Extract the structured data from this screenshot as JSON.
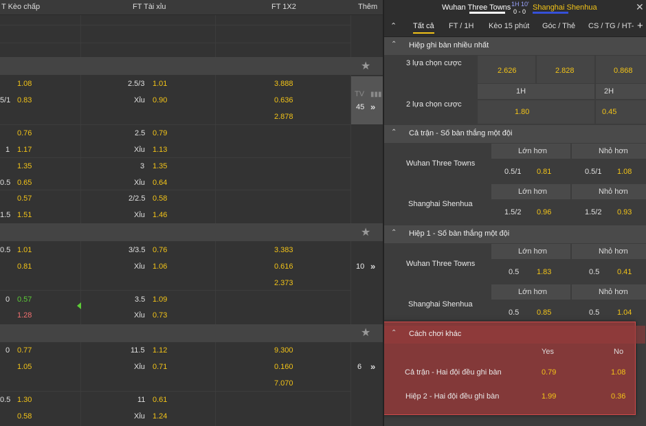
{
  "left": {
    "headers": {
      "handicap": "T Kèo chấp",
      "ou": "FT Tài xỉu",
      "x12": "FT 1X2",
      "more": "Thêm"
    },
    "tv": {
      "label": "TV",
      "count": "45"
    },
    "more_counts": [
      "10",
      "6"
    ],
    "rows": [
      {
        "h_line": "",
        "h_odds": "1.08",
        "o_line": "2.5/3",
        "o_odds": "1.01",
        "x": "3.888"
      },
      {
        "h_line": "5/1",
        "h_odds": "0.83",
        "o_line": "Xỉu",
        "o_odds": "0.90",
        "x": "0.636"
      },
      {
        "x": "2.878"
      },
      {
        "h_line": "",
        "h_odds": "0.76",
        "o_line": "2.5",
        "o_odds": "0.79"
      },
      {
        "h_line": "1",
        "h_odds": "1.17",
        "o_line": "Xỉu",
        "o_odds": "1.13"
      },
      {
        "h_line": "",
        "h_odds": "1.35",
        "o_line": "3",
        "o_odds": "1.35"
      },
      {
        "h_line": "0.5",
        "h_odds": "0.65",
        "o_line": "Xỉu",
        "o_odds": "0.64"
      },
      {
        "h_line": "",
        "h_odds": "0.57",
        "o_line": "2/2.5",
        "o_odds": "0.58"
      },
      {
        "h_line": "1.5",
        "h_odds": "1.51",
        "o_line": "Xỉu",
        "o_odds": "1.46"
      },
      {
        "h_line": "0.5",
        "h_odds": "1.01",
        "o_line": "3/3.5",
        "o_odds": "0.76",
        "x": "3.383"
      },
      {
        "h_line": "",
        "h_odds": "0.81",
        "o_line": "Xỉu",
        "o_odds": "1.06",
        "x": "0.616"
      },
      {
        "x": "2.373"
      },
      {
        "h_line": "0",
        "h_odds": "0.57",
        "o_line": "3.5",
        "o_odds": "1.09"
      },
      {
        "h_line": "",
        "h_odds": "1.28",
        "o_line": "Xỉu",
        "o_odds": "0.73"
      },
      {
        "h_line": "0",
        "h_odds": "0.77",
        "o_line": "11.5",
        "o_odds": "1.12",
        "x": "9.300"
      },
      {
        "h_line": "",
        "h_odds": "1.05",
        "o_line": "Xỉu",
        "o_odds": "0.71",
        "x": "0.160"
      },
      {
        "x": "7.070"
      },
      {
        "h_line": "0.5",
        "h_odds": "1.30",
        "o_line": "11",
        "o_odds": "0.61"
      },
      {
        "h_line": "",
        "h_odds": "0.58",
        "o_line": "Xỉu",
        "o_odds": "1.24"
      }
    ]
  },
  "right": {
    "match": {
      "home": "Wuhan Three Towns",
      "time": "1H 10'",
      "score": "0 - 0",
      "away": "Shanghai Shenhua"
    },
    "tabs": [
      "Tất cả",
      "FT / 1H",
      "Kèo 15 phút",
      "Góc / Thẻ",
      "CS / TG / HT-"
    ],
    "s1": {
      "title": "Hiệp ghi bàn nhiều nhất",
      "r1_label": "3 lựa chọn cược",
      "r1_odds": [
        "2.626",
        "2.828",
        "0.868"
      ],
      "h1": "1H",
      "h2": "2H",
      "r2_label": "2 lựa chọn cược",
      "r2_odds": [
        "1.80",
        "0.45"
      ]
    },
    "s2": {
      "title": "Cả trận - Số bàn thắng một đội",
      "over": "Lớn hơn",
      "under": "Nhỏ hơn",
      "teams": [
        {
          "name": "Wuhan Three Towns",
          "ol": "0.5/1",
          "oo": "0.81",
          "ul": "0.5/1",
          "uo": "1.08"
        },
        {
          "name": "Shanghai Shenhua",
          "ol": "1.5/2",
          "oo": "0.96",
          "ul": "1.5/2",
          "uo": "0.93"
        }
      ]
    },
    "s3": {
      "title": "Hiệp 1 - Số bàn thắng một đội",
      "over": "Lớn hơn",
      "under": "Nhỏ hơn",
      "teams": [
        {
          "name": "Wuhan Three Towns",
          "ol": "0.5",
          "oo": "1.83",
          "ul": "0.5",
          "uo": "0.41"
        },
        {
          "name": "Shanghai Shenhua",
          "ol": "0.5",
          "oo": "0.85",
          "ul": "0.5",
          "uo": "1.04"
        }
      ]
    },
    "s4": {
      "title": "Cách chơi khác",
      "yes": "Yes",
      "no": "No",
      "rows": [
        {
          "label": "Cả trận - Hai đội đều ghi bàn",
          "yes": "0.79",
          "no": "1.08"
        },
        {
          "label": "Hiệp 2 - Hai đội đều ghi bàn",
          "yes": "1.99",
          "no": "0.36"
        }
      ]
    }
  }
}
